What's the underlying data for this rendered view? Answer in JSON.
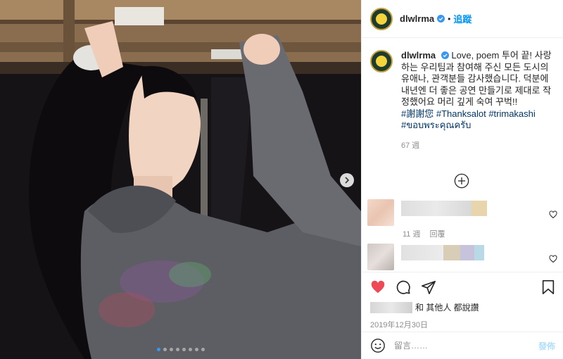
{
  "post": {
    "username": "dlwlrma",
    "follow_label": "追蹤",
    "separator": "•"
  },
  "caption": {
    "username": "dlwlrma",
    "text": "Love, poem 투어 끝! 사랑하는 우리팀과 참여해 주신 모든 도시의 유애나, 관객분들 감사했습니다. 덕분에 내년엔 더 좋은 공연 만들기로 제대로 작정했어요 머리 깊게 숙여 꾸벅!!",
    "hashtags": [
      "#謝謝您",
      "#Thanksalot",
      "#trimakashi",
      "#ขอบพระคุณครับ"
    ],
    "time": "67 週"
  },
  "comments": [
    {
      "time": "11 週",
      "reply_label": "回覆"
    }
  ],
  "likes": {
    "suffix": "和 其他人 都說讚"
  },
  "date": "2019年12月30日",
  "composer": {
    "placeholder": "留言……",
    "post_label": "發佈"
  },
  "carousel": {
    "slides": 8,
    "active_index": 0
  },
  "colors": {
    "accent": "#0095f6",
    "like_red": "#ed4956",
    "post_disabled": "#b2dffc"
  },
  "icons": [
    "verified-badge-icon",
    "next-arrow-icon",
    "add-circle-icon",
    "heart-icon",
    "comment-icon",
    "share-icon",
    "bookmark-icon",
    "emoji-icon"
  ]
}
